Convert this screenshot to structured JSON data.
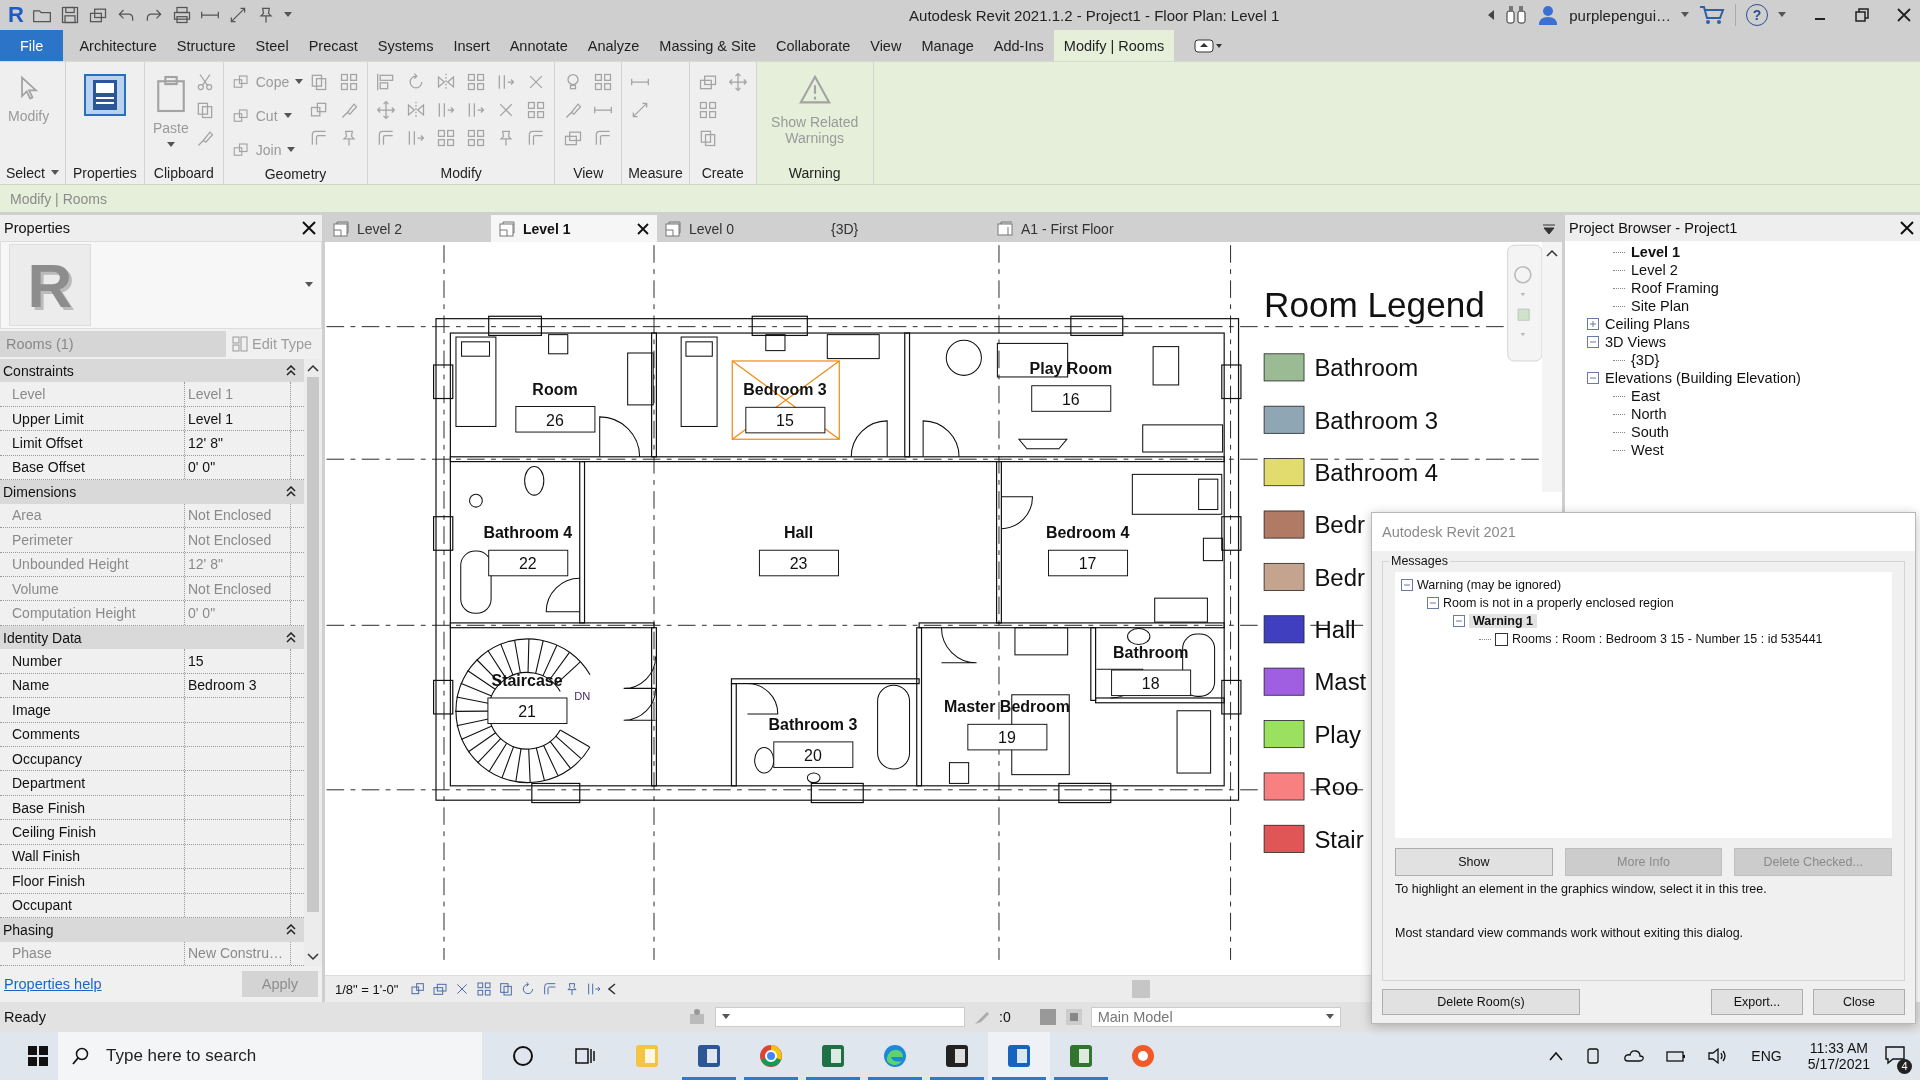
{
  "title_bar": {
    "logo": "R",
    "title": "Autodesk Revit 2021.1.2 - Project1 - Floor Plan: Level 1",
    "user": "purplepengui…",
    "help": "?"
  },
  "ribbon_tabs": [
    {
      "label": "File",
      "kind": "file",
      "selected": false
    },
    {
      "label": "Architecture",
      "kind": "tab",
      "selected": false
    },
    {
      "label": "Structure",
      "kind": "tab",
      "selected": false
    },
    {
      "label": "Steel",
      "kind": "tab",
      "selected": false
    },
    {
      "label": "Precast",
      "kind": "tab",
      "selected": false
    },
    {
      "label": "Systems",
      "kind": "tab",
      "selected": false
    },
    {
      "label": "Insert",
      "kind": "tab",
      "selected": false
    },
    {
      "label": "Annotate",
      "kind": "tab",
      "selected": false
    },
    {
      "label": "Analyze",
      "kind": "tab",
      "selected": false
    },
    {
      "label": "Massing & Site",
      "kind": "tab",
      "selected": false
    },
    {
      "label": "Collaborate",
      "kind": "tab",
      "selected": false
    },
    {
      "label": "View",
      "kind": "tab",
      "selected": false
    },
    {
      "label": "Manage",
      "kind": "tab",
      "selected": false
    },
    {
      "label": "Add-Ins",
      "kind": "tab",
      "selected": false
    },
    {
      "label": "Modify | Rooms",
      "kind": "tab",
      "selected": true
    }
  ],
  "ribbon_panels": [
    {
      "label": "Select",
      "dropdown": true,
      "contextual": false,
      "tools": [
        {
          "label": "Modify",
          "kind": "large",
          "disabled": true
        }
      ]
    },
    {
      "label": "Properties",
      "dropdown": false,
      "contextual": false,
      "tools": [
        {
          "kind": "toggle",
          "on": true
        }
      ]
    },
    {
      "label": "Clipboard",
      "dropdown": false,
      "contextual": false,
      "tools": [
        {
          "label": "Paste",
          "kind": "large",
          "disabled": true
        }
      ]
    },
    {
      "label": "Geometry",
      "dropdown": false,
      "contextual": false,
      "tools": [
        {
          "label": "Cope",
          "kind": "small",
          "disabled": true
        },
        {
          "label": "Cut",
          "kind": "small",
          "disabled": true
        },
        {
          "label": "Join",
          "kind": "small",
          "disabled": true
        }
      ]
    },
    {
      "label": "Modify",
      "dropdown": false,
      "contextual": false
    },
    {
      "label": "View",
      "dropdown": false,
      "contextual": false
    },
    {
      "label": "Measure",
      "dropdown": false,
      "contextual": false
    },
    {
      "label": "Create",
      "dropdown": false,
      "contextual": false
    },
    {
      "label": "Warning",
      "dropdown": false,
      "contextual": true,
      "tools": [
        {
          "label": "Show Related Warnings",
          "kind": "large",
          "disabled": true
        }
      ]
    }
  ],
  "options_bar": {
    "label": "Modify | Rooms"
  },
  "properties": {
    "title": "Properties",
    "preview_letter": "R",
    "type_selector": "Rooms (1)",
    "edit_type": "Edit Type",
    "groups": [
      {
        "name": "Constraints",
        "expanded": true,
        "rows": [
          {
            "label": "Level",
            "value": "Level 1",
            "disabled": true
          },
          {
            "label": "Upper Limit",
            "value": "Level 1",
            "disabled": false
          },
          {
            "label": "Limit Offset",
            "value": "12'  8\"",
            "disabled": false
          },
          {
            "label": "Base Offset",
            "value": "0'  0\"",
            "disabled": false
          }
        ]
      },
      {
        "name": "Dimensions",
        "expanded": true,
        "rows": [
          {
            "label": "Area",
            "value": "Not Enclosed",
            "disabled": true
          },
          {
            "label": "Perimeter",
            "value": "Not Enclosed",
            "disabled": true
          },
          {
            "label": "Unbounded Height",
            "value": "12'  8\"",
            "disabled": true
          },
          {
            "label": "Volume",
            "value": "Not Enclosed",
            "disabled": true
          },
          {
            "label": "Computation Height",
            "value": "0'  0\"",
            "disabled": true
          }
        ]
      },
      {
        "name": "Identity Data",
        "expanded": true,
        "rows": [
          {
            "label": "Number",
            "value": "15",
            "disabled": false
          },
          {
            "label": "Name",
            "value": "Bedroom 3",
            "disabled": false
          },
          {
            "label": "Image",
            "disabled": false
          },
          {
            "label": "Comments",
            "disabled": false
          },
          {
            "label": "Occupancy",
            "disabled": false
          },
          {
            "label": "Department",
            "disabled": false
          },
          {
            "label": "Base Finish",
            "disabled": false
          },
          {
            "label": "Ceiling Finish",
            "disabled": false
          },
          {
            "label": "Wall Finish",
            "disabled": false
          },
          {
            "label": "Floor Finish",
            "disabled": false
          },
          {
            "label": "Occupant",
            "disabled": false
          }
        ]
      },
      {
        "name": "Phasing",
        "expanded": true,
        "rows": [
          {
            "label": "Phase",
            "value": "New Constru…",
            "disabled": true
          }
        ]
      }
    ],
    "help_link": "Properties help",
    "apply": "Apply"
  },
  "view_tabs": [
    {
      "label": "Level 2",
      "kind": "plan",
      "selected": false
    },
    {
      "label": "Level 1",
      "kind": "plan",
      "selected": true
    },
    {
      "label": "Level 0",
      "kind": "plan",
      "selected": false
    },
    {
      "label": "{3D}",
      "kind": "model",
      "selected": false
    },
    {
      "label": "A1 - First Floor",
      "kind": "sheet",
      "selected": false
    }
  ],
  "floor_plan": {
    "rooms": [
      {
        "name": "Room",
        "number": "26",
        "selected": false
      },
      {
        "name": "Bedroom 3",
        "number": "15",
        "selected": true
      },
      {
        "name": "Play Room",
        "number": "16",
        "selected": false
      },
      {
        "name": "Bathroom 4",
        "number": "22",
        "selected": false
      },
      {
        "name": "Hall",
        "number": "23",
        "selected": false
      },
      {
        "name": "Bedroom 4",
        "number": "17",
        "selected": false
      },
      {
        "name": "Staircase",
        "number": "21",
        "selected": false
      },
      {
        "name": "Bathroom",
        "number": "18",
        "selected": false
      },
      {
        "name": "Bathroom 3",
        "number": "20",
        "selected": false
      },
      {
        "name": "Master Bedroom",
        "number": "19",
        "selected": false
      }
    ],
    "stair_label": "DN",
    "legend": {
      "title": "Room Legend",
      "items": [
        {
          "label": "Bathroom",
          "color": "#9bbb94"
        },
        {
          "label": "Bathroom 3",
          "color": "#8fa6b4"
        },
        {
          "label": "Bathroom 4",
          "color": "#e2dc6e"
        },
        {
          "label": "Bedr",
          "color": "#b07a64"
        },
        {
          "label": "Bedr",
          "color": "#c4a48e"
        },
        {
          "label": "Hall",
          "color": "#3f3fbf"
        },
        {
          "label": "Mast",
          "color": "#a05fe0"
        },
        {
          "label": "Play",
          "color": "#9be05f"
        },
        {
          "label": "Roo",
          "color": "#f88080"
        },
        {
          "label": "Stair",
          "color": "#e05555"
        }
      ]
    }
  },
  "view_control_bar": {
    "scale": "1/8\" = 1'-0\""
  },
  "project_browser": {
    "title": "Project Browser - Project1",
    "tree": [
      {
        "children": [
          {
            "label": "Level 1",
            "current": true
          },
          {
            "label": "Level 2",
            "current": false
          },
          {
            "label": "Roof Framing",
            "current": false
          },
          {
            "label": "Site Plan",
            "current": false
          }
        ]
      },
      {
        "label": "Ceiling Plans",
        "expanded": false
      },
      {
        "label": "3D Views",
        "expanded": true,
        "children": [
          {
            "label": "{3D}",
            "current": false
          }
        ]
      },
      {
        "label": "Elevations (Building Elevation)",
        "expanded": true,
        "children": [
          {
            "label": "East",
            "current": false
          },
          {
            "label": "North",
            "current": false
          },
          {
            "label": "South",
            "current": false
          },
          {
            "label": "West",
            "current": false
          }
        ]
      }
    ]
  },
  "status_bar": {
    "status": "Ready",
    "count": ":0",
    "model": "Main Model"
  },
  "dialog": {
    "title": "Autodesk Revit 2021",
    "group": "Messages",
    "tree": [
      {
        "label": "Warning (may be ignored)",
        "expanded": true,
        "selected": false,
        "children": [
          {
            "label": "Room is not in a properly enclosed region",
            "expanded": true,
            "selected": false,
            "children": [
              {
                "label": "Warning 1",
                "expanded": true,
                "selected": true,
                "children": [
                  {
                    "label": "Rooms : Room : Bedroom 3 15 - Number 15 : id 535441",
                    "checked": false,
                    "selected": false
                  }
                ]
              }
            ]
          }
        ]
      }
    ],
    "buttons": [
      {
        "label": "Show",
        "disabled": false
      },
      {
        "label": "More Info",
        "disabled": true
      },
      {
        "label": "Delete Checked...",
        "disabled": true
      }
    ],
    "hints": [
      "To highlight an element in the graphics window, select it in this tree.",
      "Most standard view commands work without exiting this dialog."
    ],
    "footer_buttons": [
      {
        "label": "Delete Room(s)"
      },
      {
        "label": "Export..."
      },
      {
        "label": "Close"
      }
    ]
  },
  "taskbar": {
    "search_placeholder": "Type here to search",
    "apps": [
      {
        "running": false,
        "active": false
      },
      {
        "running": false,
        "active": false
      },
      {
        "running": false,
        "active": false
      },
      {
        "running": true,
        "active": false
      },
      {
        "running": true,
        "active": false
      },
      {
        "running": true,
        "active": false
      },
      {
        "running": true,
        "active": false
      },
      {
        "running": true,
        "active": false
      },
      {
        "running": true,
        "active": true
      },
      {
        "running": true,
        "active": false
      },
      {
        "running": false,
        "active": false
      }
    ],
    "language": "ENG",
    "time": "11:33 AM",
    "date": "5/17/2021",
    "notifications": "4"
  }
}
